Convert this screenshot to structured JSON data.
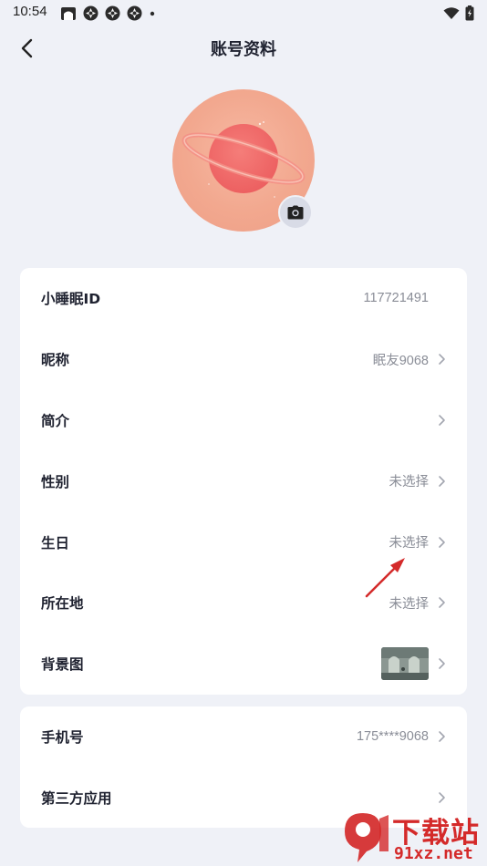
{
  "status_bar": {
    "time": "10:54",
    "icons": [
      "gallery-icon",
      "pinwheel-icon",
      "pinwheel-icon",
      "pinwheel-icon",
      "dot-icon",
      "wifi-icon",
      "battery-icon"
    ]
  },
  "header": {
    "title": "账号资料"
  },
  "profile_rows": [
    {
      "label": "小睡眠ID",
      "value": "117721491"
    },
    {
      "label": "昵称",
      "value": "眠友9068"
    },
    {
      "label": "简介",
      "value": ""
    },
    {
      "label": "性别",
      "value": "未选择"
    },
    {
      "label": "生日",
      "value": "未选择"
    },
    {
      "label": "所在地",
      "value": "未选择"
    },
    {
      "label": "背景图",
      "value": ""
    }
  ],
  "account_rows": [
    {
      "label": "手机号",
      "value": "175****9068"
    },
    {
      "label": "第三方应用",
      "value": ""
    }
  ],
  "watermark": {
    "top": "下载站",
    "bottom": "91xz.net"
  },
  "colors": {
    "background": "#eff1f7",
    "card": "#ffffff",
    "avatar": "#f2a88f",
    "planet": "#f0696a",
    "annotation_arrow": "#d42a2a"
  }
}
